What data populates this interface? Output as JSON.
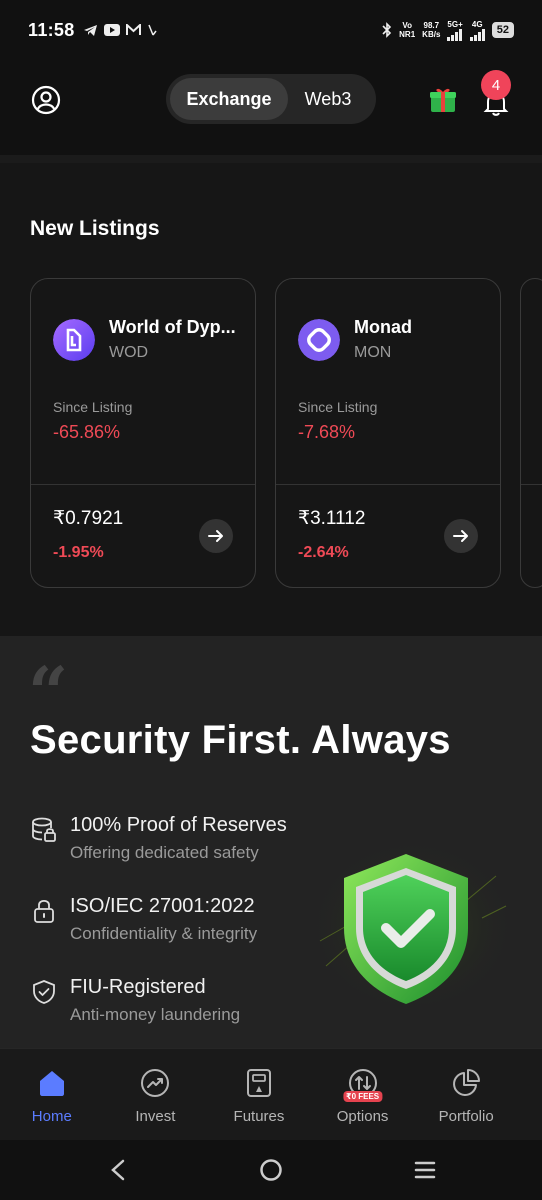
{
  "status_bar": {
    "time": "11:58",
    "net_vo": "Vo",
    "net_nr": "NR1",
    "speed": "98.7",
    "speed_unit": "KB/s",
    "net_5g": "5G+",
    "net_4g": "4G",
    "battery": "52"
  },
  "top_nav": {
    "tabs": [
      {
        "label": "Exchange",
        "active": true
      },
      {
        "label": "Web3",
        "active": false
      }
    ],
    "notification_count": "4"
  },
  "new_listings": {
    "title": "New Listings",
    "cards": [
      {
        "name": "World of Dyp...",
        "symbol": "WOD",
        "since_label": "Since Listing",
        "since_value": "-65.86%",
        "price": "₹0.7921",
        "change": "-1.95%",
        "icon_color": "#7b5cff"
      },
      {
        "name": "Monad",
        "symbol": "MON",
        "since_label": "Since Listing",
        "since_value": "-7.68%",
        "price": "₹3.1112",
        "change": "-2.64%",
        "icon_color": "#7d5cf0"
      }
    ]
  },
  "security": {
    "heading": "Security First. Always",
    "features": [
      {
        "title": "100% Proof of Reserves",
        "subtitle": "Offering dedicated safety",
        "icon": "database-lock-icon"
      },
      {
        "title": "ISO/IEC 27001:2022",
        "subtitle": "Confidentiality & integrity",
        "icon": "lock-icon"
      },
      {
        "title": "FIU-Registered",
        "subtitle": "Anti-money laundering",
        "icon": "shield-check-icon"
      }
    ]
  },
  "bottom_nav": {
    "items": [
      {
        "label": "Home",
        "active": true,
        "icon": "home-icon"
      },
      {
        "label": "Invest",
        "active": false,
        "icon": "trend-icon"
      },
      {
        "label": "Futures",
        "active": false,
        "icon": "futures-icon"
      },
      {
        "label": "Options",
        "active": false,
        "icon": "options-icon",
        "tag": "₹0 FEES"
      },
      {
        "label": "Portfolio",
        "active": false,
        "icon": "pie-chart-icon"
      }
    ]
  },
  "colors": {
    "accent": "#5b7cff",
    "negative": "#ef4a56",
    "background": "#111111"
  }
}
